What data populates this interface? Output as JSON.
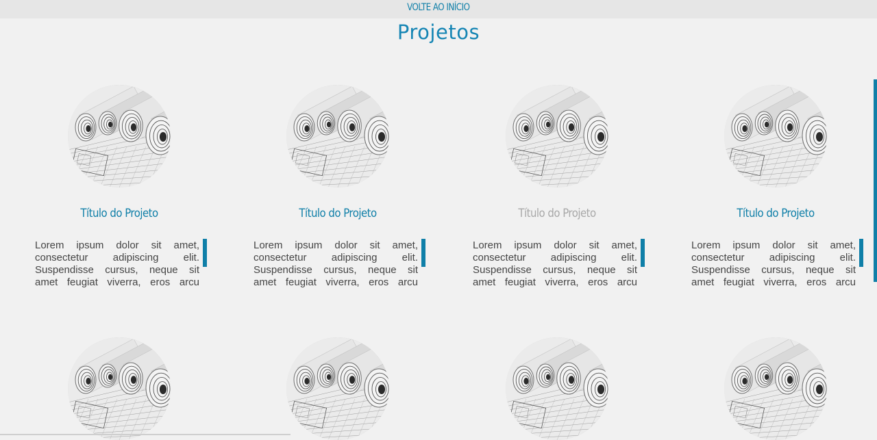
{
  "nav": {
    "back_label": "VOLTE AO INÍCIO"
  },
  "page": {
    "title": "Projetos"
  },
  "projects": [
    {
      "title": "Título do Projeto",
      "description": "Lorem ipsum dolor sit amet, consectetur adipiscing elit. Suspendisse cursus, neque sit amet feugiat viverra, eros arcu luctus lorem, a ultrices nisl ipsum id elit.",
      "title_color": "#0f7fa8"
    },
    {
      "title": "Título do Projeto",
      "description": "Lorem ipsum dolor sit amet, consectetur adipiscing elit. Suspendisse cursus, neque sit amet feugiat viverra, eros arcu luctus lorem, a ultrices nisl ipsum id elit.",
      "title_color": "#0f7fa8"
    },
    {
      "title": "Título do Projeto",
      "description": "Lorem ipsum dolor sit amet, consectetur adipiscing elit. Suspendisse cursus, neque sit amet feugiat viverra, eros arcu luctus lorem, a ultrices nisl ipsum id elit.",
      "title_color": "#a8a8a8"
    },
    {
      "title": "Título do Projeto",
      "description": "Lorem ipsum dolor sit amet, consectetur adipiscing elit. Suspendisse cursus, neque sit amet feugiat viverra, eros arcu luctus lorem, a ultrices nisl ipsum id elit.",
      "title_color": "#0f7fa8"
    },
    {
      "title": "",
      "description": ""
    },
    {
      "title": "",
      "description": ""
    },
    {
      "title": "",
      "description": ""
    },
    {
      "title": "",
      "description": ""
    }
  ],
  "colors": {
    "accent": "#0f7fa8",
    "title": "#1585b4",
    "background": "#f1f1f1",
    "muted_title": "#a8a8a8"
  },
  "icons": {
    "project_thumbnail": "blueprint-rolls-image"
  }
}
